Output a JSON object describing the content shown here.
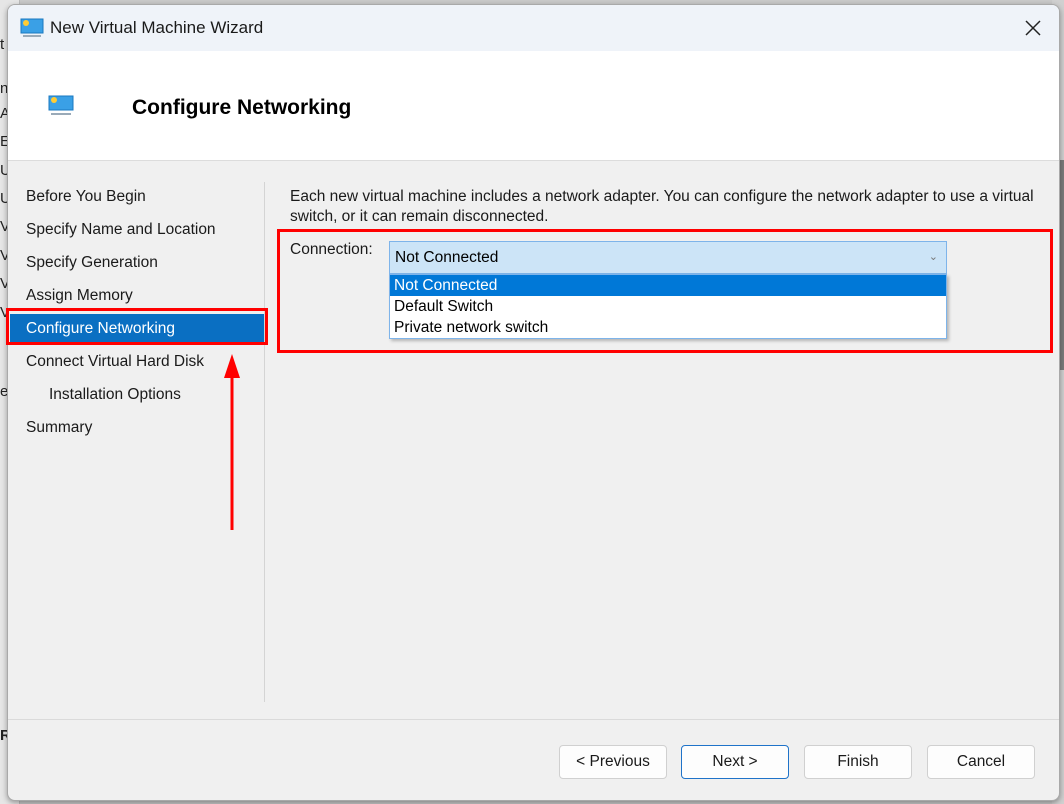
{
  "window": {
    "title": "New Virtual Machine Wizard",
    "close_icon": "close-icon",
    "app_icon": "virtual-machine-icon"
  },
  "header": {
    "title": "Configure Networking",
    "icon": "virtual-machine-icon"
  },
  "nav": {
    "items": [
      {
        "label": "Before You Begin",
        "selected": false,
        "indent": false
      },
      {
        "label": "Specify Name and Location",
        "selected": false,
        "indent": false
      },
      {
        "label": "Specify Generation",
        "selected": false,
        "indent": false
      },
      {
        "label": "Assign Memory",
        "selected": false,
        "indent": false
      },
      {
        "label": "Configure Networking",
        "selected": true,
        "indent": false
      },
      {
        "label": "Connect Virtual Hard Disk",
        "selected": false,
        "indent": false
      },
      {
        "label": "Installation Options",
        "selected": false,
        "indent": true
      },
      {
        "label": "Summary",
        "selected": false,
        "indent": false
      }
    ]
  },
  "content": {
    "description": "Each new virtual machine includes a network adapter. You can configure the network adapter to use a virtual switch, or it can remain disconnected.",
    "connection_label": "Connection:",
    "connection_value": "Not Connected",
    "dropdown_options": [
      "Not Connected",
      "Default Switch",
      "Private network switch"
    ],
    "dropdown_selected_index": 0
  },
  "buttons": {
    "previous": "< Previous",
    "next": "Next >",
    "finish": "Finish",
    "cancel": "Cancel"
  },
  "background_fragments": [
    "t",
    "n",
    "A",
    "E",
    "U",
    "U",
    "V",
    "V",
    "V",
    "V",
    "e",
    "R"
  ],
  "colors": {
    "selection": "#0a6fc2",
    "dropdown_highlight": "#0078d7",
    "combo_bg": "#cce4f7",
    "annotation": "#ff0000"
  }
}
